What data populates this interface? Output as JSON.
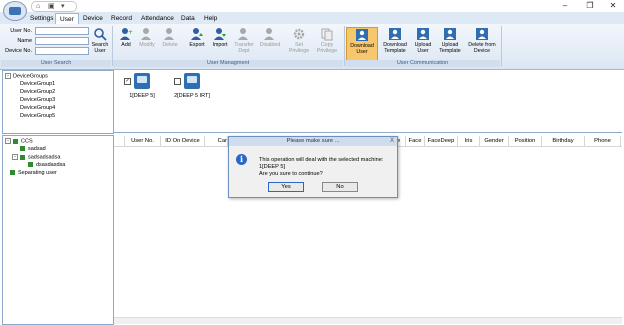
{
  "titlebar": {
    "quick_access": [
      "home-icon",
      "save-icon",
      "dropdown-icon"
    ],
    "window_controls": [
      "minimize",
      "restore",
      "close"
    ],
    "window_glyphs": [
      "–",
      "❐",
      "✕"
    ]
  },
  "menu": {
    "tabs": [
      "Settings",
      "User",
      "Device",
      "Record",
      "Attendance",
      "Data",
      "Help"
    ],
    "active": "User"
  },
  "ribbon": {
    "search": {
      "user_no_label": "User No.",
      "name_label": "Name",
      "device_no_label": "Device No.",
      "search_button": "Search User",
      "group_label": "User Search"
    },
    "management": {
      "buttons": [
        "Add",
        "Modify",
        "Delete",
        "Export",
        "Import",
        "Transfer Dept",
        "Disabled",
        "Set Privilege",
        "Copy Privilege"
      ],
      "group_label": "User Managment"
    },
    "communication": {
      "buttons": [
        "Download User",
        "Download Template",
        "Upload User",
        "Upload Template",
        "Delete from Device"
      ],
      "group_label": "User Communication",
      "selected": "Download User"
    }
  },
  "device_groups": {
    "root": "DeviceGroups",
    "items": [
      "DeviceGroup1",
      "DeviceGroup2",
      "DeviceGroup3",
      "DeviceGroup4",
      "DeviceGroup5"
    ]
  },
  "devices": [
    {
      "label": "1[DEEP 5]",
      "checked": true
    },
    {
      "label": "2[DEEP 5 IRT]",
      "checked": false
    }
  ],
  "dept_tree": {
    "root": "CCS",
    "children": [
      "sadsad",
      "sadsadsadsa"
    ],
    "grandchild": "dsasdasdsa",
    "other": "Separating user"
  },
  "table": {
    "columns": [
      "User No.",
      "ID On Device",
      "Card",
      "Face",
      "FaceDeep",
      "Iris",
      "Gender",
      "Position",
      "Birthday",
      "Phone"
    ],
    "partial_columns": [
      "Car",
      "e"
    ]
  },
  "dialog": {
    "title": "Please make sure ...",
    "close": "X",
    "line1": "This operation will deal with the selected machine:",
    "line2": "1[DEEP 5]",
    "line3": "Are you sure to continue?",
    "yes": "Yes",
    "no": "No"
  },
  "colors": {
    "accent": "#2a68c6",
    "selected_ribbon": "#f8c76d",
    "group_green": "#2e8b2e"
  }
}
